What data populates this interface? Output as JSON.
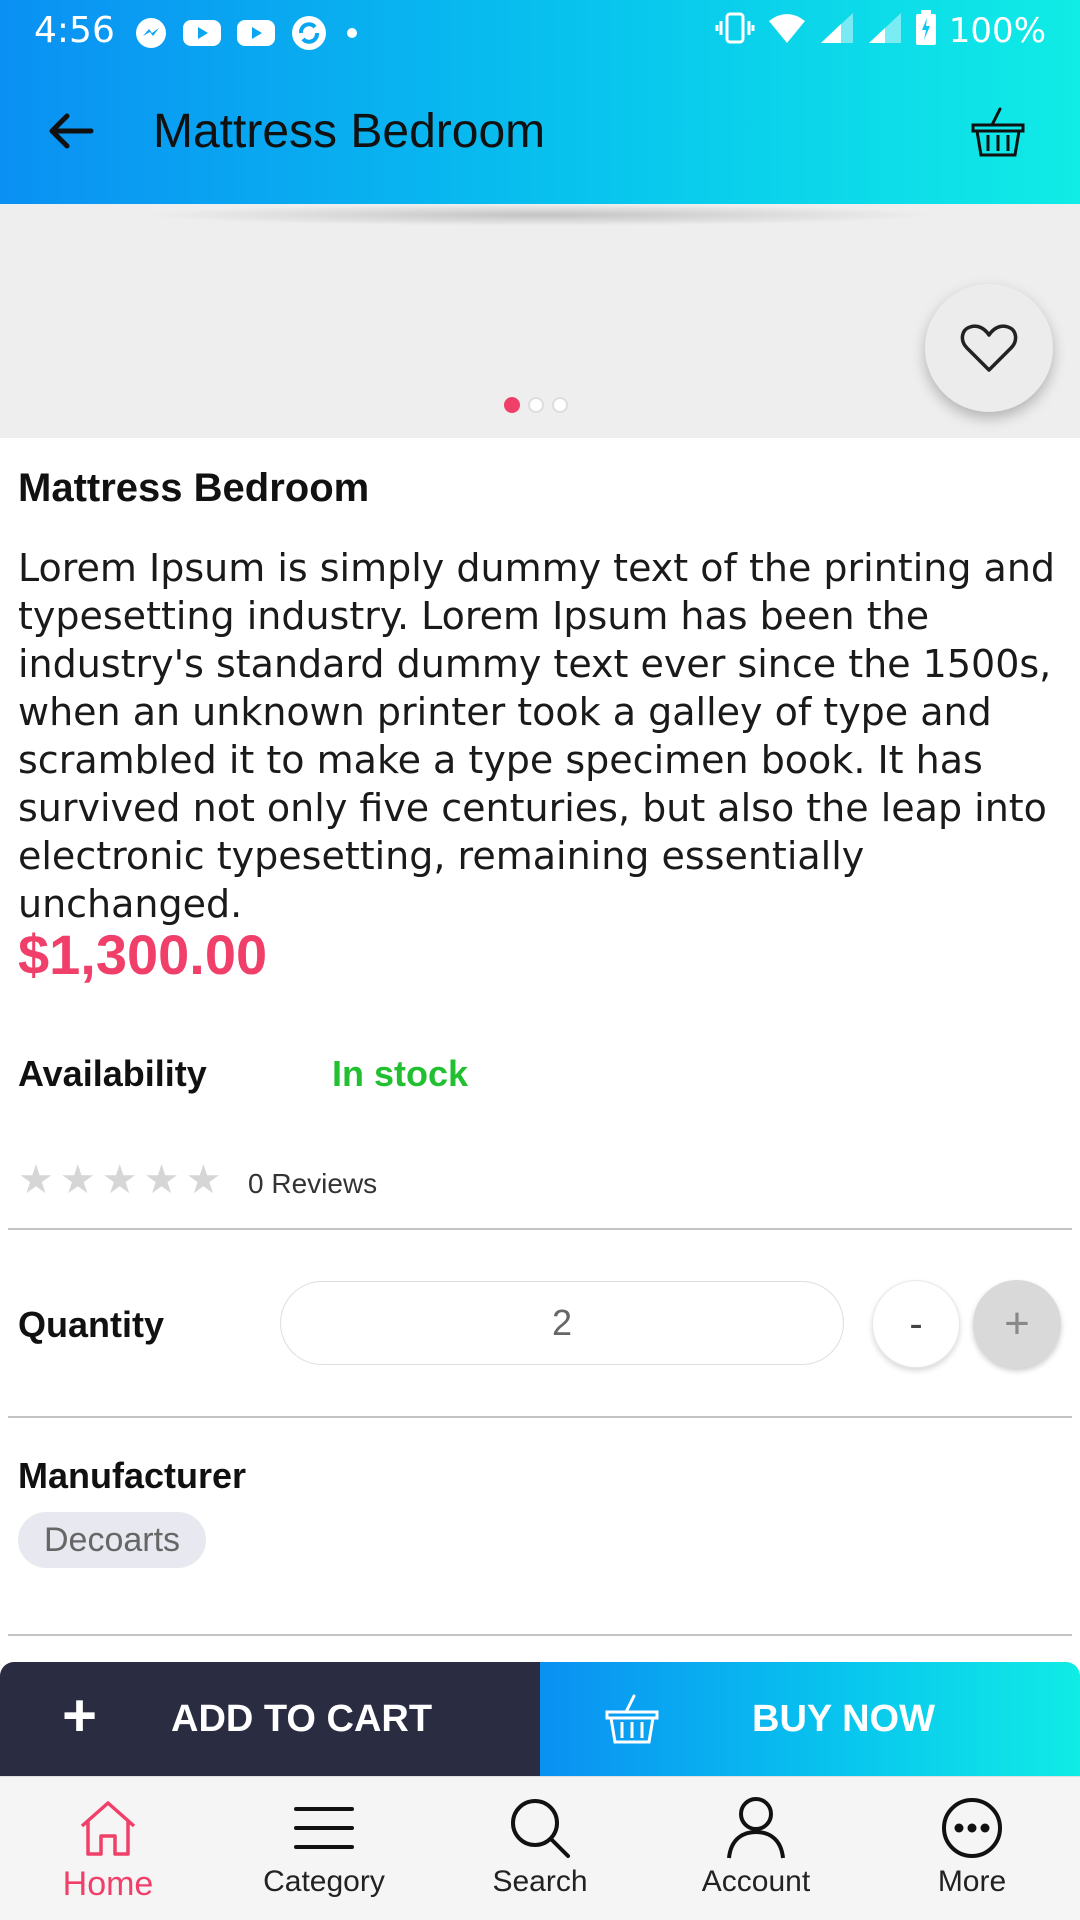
{
  "status_bar": {
    "time": "4:56",
    "battery": "100%"
  },
  "header": {
    "title": "Mattress Bedroom"
  },
  "gallery": {
    "slide_count": 3,
    "active_slide": 1
  },
  "product": {
    "name": "Mattress Bedroom",
    "description": "Lorem Ipsum is simply dummy text of the printing and typesetting industry. Lorem Ipsum has been the industry's standard dummy text ever since the 1500s, when an unknown printer took a galley of type and scrambled it to make a type specimen book. It has survived not only five centuries, but also the leap into electronic typesetting, remaining essentially unchanged.",
    "price": "$1,300.00",
    "availability_label": "Availability",
    "availability_value": "In stock",
    "rating": 0,
    "rating_max": 5,
    "reviews": "0 Reviews"
  },
  "quantity": {
    "label": "Quantity",
    "value": "2",
    "minus": "-",
    "plus": "+"
  },
  "manufacturer": {
    "label": "Manufacturer",
    "value": "Decoarts"
  },
  "actions": {
    "add_to_cart": "ADD TO CART",
    "add_icon": "+",
    "buy_now": "BUY NOW"
  },
  "bottom_nav": {
    "home": "Home",
    "category": "Category",
    "search": "Search",
    "account": "Account",
    "more": "More"
  },
  "colors": {
    "accent": "#f0406a",
    "in_stock": "#22c030",
    "gradient_start": "#0a90f3",
    "gradient_end": "#10ece6",
    "dark_button": "#2a2c42"
  }
}
